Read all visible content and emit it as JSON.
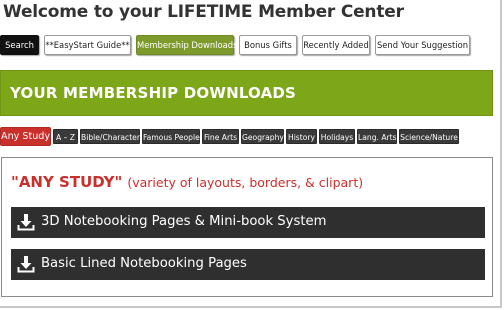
{
  "page_title": "Welcome to your LIFETIME Member Center",
  "top_nav": [
    {
      "label": "Search",
      "style": "dark"
    },
    {
      "label": "**EasyStart Guide**",
      "style": "light"
    },
    {
      "label": "Membership Downloads",
      "style": "green"
    },
    {
      "label": "Bonus Gifts",
      "style": "light"
    },
    {
      "label": "Recently Added",
      "style": "light"
    },
    {
      "label": "Send Your Suggestion",
      "style": "light"
    }
  ],
  "banner": {
    "title": "YOUR MEMBERSHIP DOWNLOADS"
  },
  "categories": [
    {
      "label": "Any Study",
      "active": true
    },
    {
      "label": "A – Z"
    },
    {
      "label": "Bible/Character"
    },
    {
      "label": "Famous People"
    },
    {
      "label": "Fine Arts"
    },
    {
      "label": "Geography"
    },
    {
      "label": "History"
    },
    {
      "label": "Holidays"
    },
    {
      "label": "Lang. Arts"
    },
    {
      "label": "Science/Nature"
    }
  ],
  "section": {
    "heading": "\"ANY STUDY\"",
    "subheading": "(variety of layouts, borders, & clipart)"
  },
  "downloads": [
    {
      "label": "3D Notebooking Pages & Mini-book System",
      "icon": "download-icon"
    },
    {
      "label": "Basic Lined Notebooking Pages",
      "icon": "download-icon"
    }
  ],
  "colors": {
    "accent_green": "#7da719",
    "nav_green": "#7d9a2a",
    "accent_red": "#c9302c",
    "dark_item": "#2f2f2f"
  }
}
